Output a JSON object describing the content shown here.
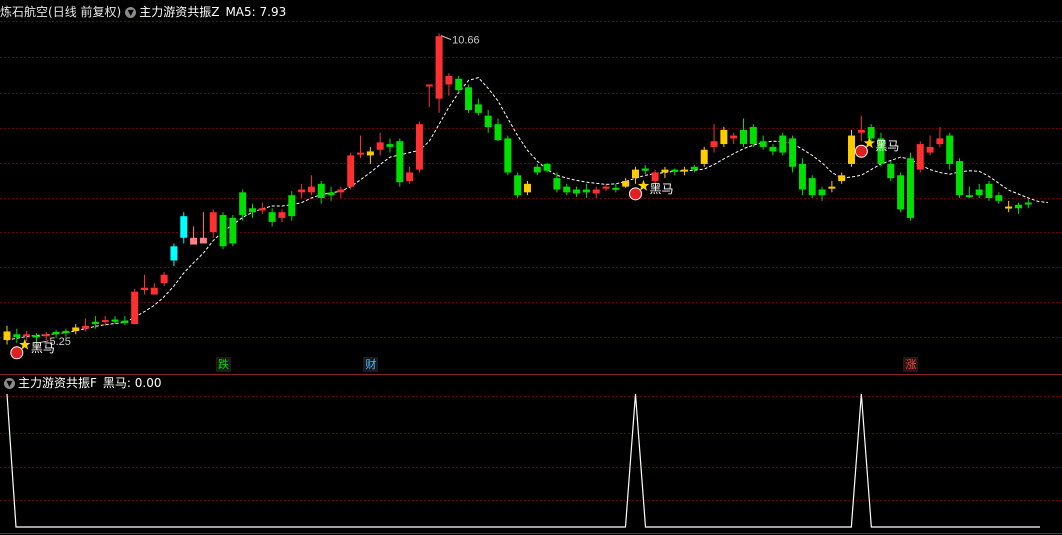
{
  "header": {
    "stock_name": "炼石航空",
    "period": "(日线 前复权)",
    "indicator_name": "主力游资共振Z",
    "ma_text": "MA5: 7.93"
  },
  "sub_header": {
    "indicator_name": "主力游资共振F",
    "value_text": "黑马: 0.00"
  },
  "markers": {
    "black_horse": "黑马",
    "events": [
      {
        "text": "跌",
        "color": "#00d800",
        "bg": "#1b1b1b"
      },
      {
        "text": "财",
        "color": "#4fb8ff",
        "bg": "#1b1b1b"
      },
      {
        "text": "涨",
        "color": "#ff4040",
        "bg": "#2a1414"
      }
    ]
  },
  "colors": {
    "up": "#ff3030",
    "down": "#00e000",
    "cyan": "#00ffff",
    "yellow": "#ffcc00",
    "pink": "#ff8080",
    "grid": "#6a0000",
    "ma": "#ffffff",
    "sub_line": "#ffffff"
  },
  "chart_data": {
    "type": "candlestick",
    "price_range": [
      5.0,
      10.9
    ],
    "price_labels": [
      {
        "index": 3,
        "value": 5.25,
        "text": "5.25"
      },
      {
        "index": 44,
        "value": 10.66,
        "text": "10.66"
      }
    ],
    "black_horse_signal_indices": [
      1,
      64,
      87
    ],
    "event_marker_indices": [
      22,
      37,
      92
    ],
    "candles": [
      {
        "o": 5.3,
        "h": 5.55,
        "l": 5.22,
        "c": 5.45,
        "col": "yellow"
      },
      {
        "o": 5.4,
        "h": 5.5,
        "l": 5.25,
        "c": 5.35,
        "col": "green"
      },
      {
        "o": 5.38,
        "h": 5.46,
        "l": 5.28,
        "c": 5.4,
        "col": "red"
      },
      {
        "o": 5.35,
        "h": 5.42,
        "l": 5.25,
        "c": 5.38,
        "col": "green"
      },
      {
        "o": 5.38,
        "h": 5.44,
        "l": 5.3,
        "c": 5.4,
        "col": "red"
      },
      {
        "o": 5.4,
        "h": 5.48,
        "l": 5.34,
        "c": 5.44,
        "col": "green"
      },
      {
        "o": 5.42,
        "h": 5.5,
        "l": 5.36,
        "c": 5.46,
        "col": "green"
      },
      {
        "o": 5.46,
        "h": 5.58,
        "l": 5.4,
        "c": 5.52,
        "col": "yellow"
      },
      {
        "o": 5.5,
        "h": 5.68,
        "l": 5.45,
        "c": 5.55,
        "col": "red"
      },
      {
        "o": 5.62,
        "h": 5.72,
        "l": 5.5,
        "c": 5.58,
        "col": "green"
      },
      {
        "o": 5.62,
        "h": 5.72,
        "l": 5.55,
        "c": 5.65,
        "col": "red"
      },
      {
        "o": 5.66,
        "h": 5.72,
        "l": 5.58,
        "c": 5.62,
        "col": "green"
      },
      {
        "o": 5.64,
        "h": 5.72,
        "l": 5.56,
        "c": 5.6,
        "col": "green"
      },
      {
        "o": 5.58,
        "h": 6.2,
        "l": 5.58,
        "c": 6.15,
        "col": "red"
      },
      {
        "o": 6.18,
        "h": 6.45,
        "l": 6.1,
        "c": 6.22,
        "col": "red"
      },
      {
        "o": 6.22,
        "h": 6.3,
        "l": 6.12,
        "c": 6.1,
        "col": "red"
      },
      {
        "o": 6.3,
        "h": 6.5,
        "l": 6.25,
        "c": 6.45,
        "col": "red"
      },
      {
        "o": 6.7,
        "h": 7.0,
        "l": 6.6,
        "c": 6.95,
        "col": "cyan"
      },
      {
        "o": 7.1,
        "h": 7.55,
        "l": 7.0,
        "c": 7.48,
        "col": "cyan"
      },
      {
        "o": 7.1,
        "h": 7.3,
        "l": 7.0,
        "c": 6.98,
        "col": "pink"
      },
      {
        "o": 7.1,
        "h": 7.55,
        "l": 7.05,
        "c": 7.0,
        "col": "pink"
      },
      {
        "o": 7.2,
        "h": 7.6,
        "l": 7.1,
        "c": 7.55,
        "col": "red"
      },
      {
        "o": 7.5,
        "h": 7.55,
        "l": 6.9,
        "c": 6.95,
        "col": "green"
      },
      {
        "o": 7.0,
        "h": 7.5,
        "l": 6.95,
        "c": 7.45,
        "col": "green"
      },
      {
        "o": 7.5,
        "h": 7.95,
        "l": 7.4,
        "c": 7.9,
        "col": "green"
      },
      {
        "o": 7.62,
        "h": 7.7,
        "l": 7.45,
        "c": 7.55,
        "col": "green"
      },
      {
        "o": 7.58,
        "h": 7.72,
        "l": 7.52,
        "c": 7.62,
        "col": "red"
      },
      {
        "o": 7.55,
        "h": 7.62,
        "l": 7.3,
        "c": 7.38,
        "col": "green"
      },
      {
        "o": 7.45,
        "h": 7.6,
        "l": 7.38,
        "c": 7.55,
        "col": "red"
      },
      {
        "o": 7.48,
        "h": 7.92,
        "l": 7.4,
        "c": 7.85,
        "col": "green"
      },
      {
        "o": 7.9,
        "h": 8.05,
        "l": 7.8,
        "c": 7.95,
        "col": "red"
      },
      {
        "o": 7.9,
        "h": 8.2,
        "l": 7.85,
        "c": 8.0,
        "col": "red"
      },
      {
        "o": 8.05,
        "h": 8.1,
        "l": 7.7,
        "c": 7.8,
        "col": "green"
      },
      {
        "o": 7.85,
        "h": 8.0,
        "l": 7.75,
        "c": 7.9,
        "col": "green"
      },
      {
        "o": 7.9,
        "h": 8.0,
        "l": 7.8,
        "c": 7.95,
        "col": "red"
      },
      {
        "o": 8.0,
        "h": 8.6,
        "l": 7.95,
        "c": 8.55,
        "col": "red"
      },
      {
        "o": 8.6,
        "h": 8.9,
        "l": 8.5,
        "c": 8.6,
        "col": "red"
      },
      {
        "o": 8.55,
        "h": 8.7,
        "l": 8.4,
        "c": 8.62,
        "col": "yellow"
      },
      {
        "o": 8.65,
        "h": 8.95,
        "l": 8.55,
        "c": 8.78,
        "col": "red"
      },
      {
        "o": 8.75,
        "h": 8.85,
        "l": 8.6,
        "c": 8.7,
        "col": "green"
      },
      {
        "o": 8.8,
        "h": 8.85,
        "l": 8.0,
        "c": 8.08,
        "col": "green"
      },
      {
        "o": 8.1,
        "h": 8.35,
        "l": 8.05,
        "c": 8.25,
        "col": "red"
      },
      {
        "o": 8.3,
        "h": 9.15,
        "l": 8.25,
        "c": 9.1,
        "col": "red"
      },
      {
        "o": 9.8,
        "h": 9.8,
        "l": 9.4,
        "c": 9.8,
        "col": "red"
      },
      {
        "o": 9.55,
        "h": 10.7,
        "l": 9.3,
        "c": 10.65,
        "col": "red"
      },
      {
        "o": 9.95,
        "h": 10.0,
        "l": 9.6,
        "c": 9.8,
        "col": "red"
      },
      {
        "o": 9.9,
        "h": 9.95,
        "l": 9.65,
        "c": 9.7,
        "col": "green"
      },
      {
        "o": 9.75,
        "h": 9.8,
        "l": 9.3,
        "c": 9.35,
        "col": "green"
      },
      {
        "o": 9.45,
        "h": 9.55,
        "l": 9.25,
        "c": 9.3,
        "col": "green"
      },
      {
        "o": 9.25,
        "h": 9.35,
        "l": 8.95,
        "c": 9.05,
        "col": "green"
      },
      {
        "o": 9.1,
        "h": 9.2,
        "l": 8.8,
        "c": 8.82,
        "col": "green"
      },
      {
        "o": 8.85,
        "h": 8.9,
        "l": 8.2,
        "c": 8.25,
        "col": "green"
      },
      {
        "o": 8.2,
        "h": 8.25,
        "l": 7.8,
        "c": 7.85,
        "col": "green"
      },
      {
        "o": 7.9,
        "h": 8.1,
        "l": 7.85,
        "c": 8.05,
        "col": "yellow"
      },
      {
        "o": 8.25,
        "h": 8.4,
        "l": 8.2,
        "c": 8.35,
        "col": "green"
      },
      {
        "o": 8.4,
        "h": 8.42,
        "l": 8.25,
        "c": 8.28,
        "col": "green"
      },
      {
        "o": 8.15,
        "h": 8.25,
        "l": 7.9,
        "c": 7.95,
        "col": "green"
      },
      {
        "o": 8.0,
        "h": 8.05,
        "l": 7.85,
        "c": 7.9,
        "col": "green"
      },
      {
        "o": 7.95,
        "h": 8.0,
        "l": 7.82,
        "c": 7.88,
        "col": "green"
      },
      {
        "o": 7.9,
        "h": 8.05,
        "l": 7.8,
        "c": 7.95,
        "col": "green"
      },
      {
        "o": 7.88,
        "h": 8.0,
        "l": 7.8,
        "c": 7.95,
        "col": "red"
      },
      {
        "o": 7.98,
        "h": 8.05,
        "l": 7.92,
        "c": 8.0,
        "col": "red"
      },
      {
        "o": 7.98,
        "h": 8.05,
        "l": 7.9,
        "c": 7.95,
        "col": "green"
      },
      {
        "o": 8.0,
        "h": 8.15,
        "l": 7.98,
        "c": 8.1,
        "col": "yellow"
      },
      {
        "o": 8.15,
        "h": 8.35,
        "l": 8.05,
        "c": 8.3,
        "col": "yellow"
      },
      {
        "o": 8.32,
        "h": 8.38,
        "l": 8.22,
        "c": 8.28,
        "col": "green"
      },
      {
        "o": 8.1,
        "h": 8.3,
        "l": 8.05,
        "c": 8.25,
        "col": "red"
      },
      {
        "o": 8.25,
        "h": 8.35,
        "l": 8.15,
        "c": 8.3,
        "col": "yellow"
      },
      {
        "o": 8.3,
        "h": 8.32,
        "l": 8.2,
        "c": 8.28,
        "col": "green"
      },
      {
        "o": 8.28,
        "h": 8.35,
        "l": 8.2,
        "c": 8.3,
        "col": "yellow"
      },
      {
        "o": 8.35,
        "h": 8.38,
        "l": 8.25,
        "c": 8.3,
        "col": "green"
      },
      {
        "o": 8.4,
        "h": 8.7,
        "l": 8.35,
        "c": 8.65,
        "col": "yellow"
      },
      {
        "o": 8.7,
        "h": 9.1,
        "l": 8.6,
        "c": 8.8,
        "col": "red"
      },
      {
        "o": 8.75,
        "h": 9.05,
        "l": 8.7,
        "c": 9.0,
        "col": "yellow"
      },
      {
        "o": 8.85,
        "h": 8.95,
        "l": 8.75,
        "c": 8.9,
        "col": "red"
      },
      {
        "o": 8.75,
        "h": 9.2,
        "l": 8.7,
        "c": 9.0,
        "col": "green"
      },
      {
        "o": 9.05,
        "h": 9.1,
        "l": 8.7,
        "c": 8.75,
        "col": "green"
      },
      {
        "o": 8.8,
        "h": 8.9,
        "l": 8.65,
        "c": 8.7,
        "col": "green"
      },
      {
        "o": 8.7,
        "h": 8.75,
        "l": 8.55,
        "c": 8.62,
        "col": "green"
      },
      {
        "o": 8.6,
        "h": 8.95,
        "l": 8.55,
        "c": 8.9,
        "col": "green"
      },
      {
        "o": 8.85,
        "h": 8.9,
        "l": 8.25,
        "c": 8.35,
        "col": "green"
      },
      {
        "o": 8.4,
        "h": 8.5,
        "l": 7.85,
        "c": 7.95,
        "col": "green"
      },
      {
        "o": 8.15,
        "h": 8.2,
        "l": 7.8,
        "c": 7.85,
        "col": "green"
      },
      {
        "o": 7.85,
        "h": 8.0,
        "l": 7.75,
        "c": 7.95,
        "col": "green"
      },
      {
        "o": 8.0,
        "h": 8.1,
        "l": 7.9,
        "c": 8.0,
        "col": "yellow"
      },
      {
        "o": 8.1,
        "h": 8.25,
        "l": 8.05,
        "c": 8.2,
        "col": "yellow"
      },
      {
        "o": 8.4,
        "h": 9.0,
        "l": 8.35,
        "c": 8.9,
        "col": "yellow"
      },
      {
        "o": 9.0,
        "h": 9.25,
        "l": 8.8,
        "c": 8.95,
        "col": "red"
      },
      {
        "o": 9.05,
        "h": 9.1,
        "l": 8.8,
        "c": 8.85,
        "col": "green"
      },
      {
        "o": 8.85,
        "h": 8.95,
        "l": 8.35,
        "c": 8.4,
        "col": "green"
      },
      {
        "o": 8.4,
        "h": 8.45,
        "l": 8.1,
        "c": 8.15,
        "col": "green"
      },
      {
        "o": 8.2,
        "h": 8.25,
        "l": 7.55,
        "c": 7.6,
        "col": "green"
      },
      {
        "o": 8.5,
        "h": 8.6,
        "l": 7.4,
        "c": 7.45,
        "col": "green"
      },
      {
        "o": 8.3,
        "h": 8.8,
        "l": 8.25,
        "c": 8.75,
        "col": "red"
      },
      {
        "o": 8.6,
        "h": 8.9,
        "l": 8.55,
        "c": 8.7,
        "col": "red"
      },
      {
        "o": 8.75,
        "h": 9.05,
        "l": 8.7,
        "c": 8.85,
        "col": "red"
      },
      {
        "o": 8.9,
        "h": 8.95,
        "l": 8.3,
        "c": 8.4,
        "col": "green"
      },
      {
        "o": 8.45,
        "h": 8.5,
        "l": 7.8,
        "c": 7.85,
        "col": "green"
      },
      {
        "o": 7.85,
        "h": 8.0,
        "l": 7.8,
        "c": 7.85,
        "col": "green"
      },
      {
        "o": 7.85,
        "h": 8.05,
        "l": 7.8,
        "c": 7.95,
        "col": "green"
      },
      {
        "o": 8.05,
        "h": 8.1,
        "l": 7.75,
        "c": 7.8,
        "col": "green"
      },
      {
        "o": 7.85,
        "h": 7.9,
        "l": 7.7,
        "c": 7.75,
        "col": "green"
      },
      {
        "o": 7.65,
        "h": 7.75,
        "l": 7.55,
        "c": 7.62,
        "col": "yellow"
      },
      {
        "o": 7.62,
        "h": 7.72,
        "l": 7.52,
        "c": 7.68,
        "col": "green"
      },
      {
        "o": 7.7,
        "h": 7.78,
        "l": 7.62,
        "c": 7.72,
        "col": "green"
      }
    ],
    "ma5": [
      5.3,
      5.33,
      5.36,
      5.38,
      5.39,
      5.41,
      5.43,
      5.46,
      5.5,
      5.54,
      5.57,
      5.59,
      5.61,
      5.7,
      5.8,
      5.91,
      6.06,
      6.25,
      6.48,
      6.66,
      6.83,
      7.05,
      7.21,
      7.33,
      7.46,
      7.55,
      7.61,
      7.66,
      7.66,
      7.68,
      7.72,
      7.8,
      7.86,
      7.89,
      7.92,
      8.0,
      8.12,
      8.25,
      8.39,
      8.52,
      8.56,
      8.6,
      8.64,
      8.8,
      9.1,
      9.4,
      9.66,
      9.87,
      9.92,
      9.73,
      9.51,
      9.2,
      8.9,
      8.64,
      8.45,
      8.3,
      8.2,
      8.15,
      8.11,
      8.08,
      8.06,
      8.04,
      8.05,
      8.09,
      8.15,
      8.2,
      8.23,
      8.25,
      8.27,
      8.28,
      8.29,
      8.31,
      8.39,
      8.49,
      8.58,
      8.67,
      8.73,
      8.78,
      8.8,
      8.79,
      8.76,
      8.66,
      8.55,
      8.42,
      8.25,
      8.15,
      8.17,
      8.2,
      8.3,
      8.4,
      8.46,
      8.52,
      8.48,
      8.38,
      8.3,
      8.25,
      8.22,
      8.26,
      8.28,
      8.27,
      8.18,
      8.06,
      7.94,
      7.87,
      7.8,
      7.74,
      7.72
    ]
  }
}
